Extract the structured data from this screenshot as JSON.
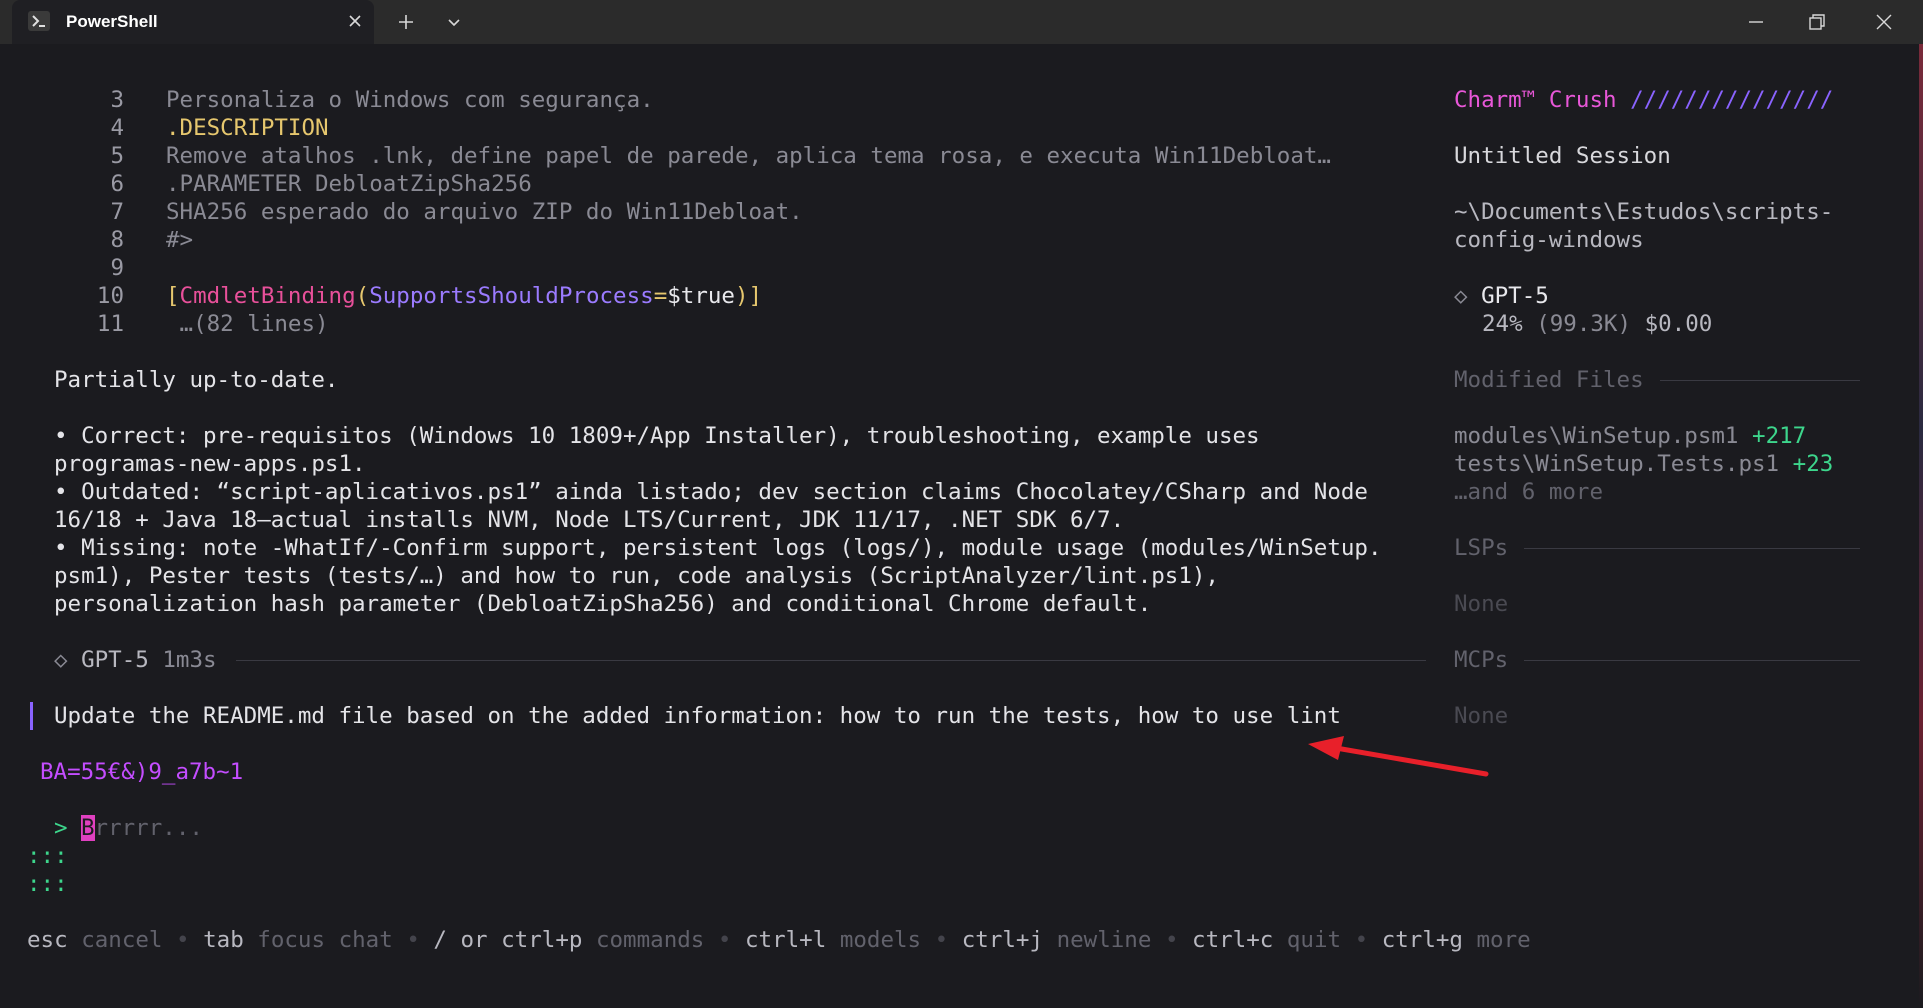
{
  "window": {
    "tab_title": "PowerShell",
    "icons": {
      "tab": "powershell-icon",
      "close": "close-icon",
      "new_tab": "plus-icon",
      "dropdown": "chevron-down-icon",
      "minimize": "minimize-icon",
      "maximize": "restore-icon",
      "window_close": "close-icon"
    }
  },
  "code": {
    "lines": [
      {
        "num": "3",
        "text": "Personaliza o Windows com segurança."
      },
      {
        "num": "4",
        "text": ".DESCRIPTION"
      },
      {
        "num": "5",
        "text": "Remove atalhos .lnk, define papel de parede, aplica tema rosa, e executa Win11Debloat…"
      },
      {
        "num": "6",
        "text": ".PARAMETER DebloatZipSha256"
      },
      {
        "num": "7",
        "text": "SHA256 esperado do arquivo ZIP do Win11Debloat."
      },
      {
        "num": "8",
        "text": "#>"
      },
      {
        "num": "9",
        "text": ""
      },
      {
        "num": "10",
        "parts": [
          "[",
          "CmdletBinding",
          "(",
          "SupportsShouldProcess",
          "=",
          "$true",
          ")]"
        ]
      },
      {
        "num": "11",
        "text": " …(82 lines)"
      }
    ]
  },
  "response": {
    "summary": "Partially up-to-date.",
    "bullets": [
      [
        "• Correct: pre-requisitos (Windows 10 1809+/App Installer), troubleshooting, example uses",
        "programas-new-apps.ps1."
      ],
      [
        "• Outdated: “script-aplicativos.ps1” ainda listado; dev section claims Chocolatey/CSharp and Node",
        "16/18 + Java 18—actual installs NVM, Node LTS/Current, JDK 11/17, .NET SDK 6/7."
      ],
      [
        "• Missing: note -WhatIf/-Confirm support, persistent logs (logs/), module usage (modules/WinSetup.",
        "psm1), Pester tests (tests/…) and how to run, code analysis (ScriptAnalyzer/lint.ps1),",
        "personalization hash parameter (DebloatZipSha256) and conditional Chrome default."
      ]
    ],
    "model_marker": "◇",
    "model": "GPT-5",
    "duration": "1m3s"
  },
  "user_message": "Update the README.md file based on the added information: how to run the tests, how to use lint",
  "spinner_text": "BA=55€&)9_a7b~1",
  "input": {
    "prompt": ">",
    "cursor_char": "B",
    "placeholder": "rrrrr...",
    "continuation": [
      ":::",
      ":::"
    ]
  },
  "shortcuts": [
    {
      "key": "esc",
      "label": "cancel"
    },
    {
      "key": "tab",
      "label": "focus chat"
    },
    {
      "key": "/ or ctrl+p",
      "label": "commands"
    },
    {
      "key": "ctrl+l",
      "label": "models"
    },
    {
      "key": "ctrl+j",
      "label": "newline"
    },
    {
      "key": "ctrl+c",
      "label": "quit"
    },
    {
      "key": "ctrl+g",
      "label": "more"
    }
  ],
  "sidebar": {
    "brand": "Charm™ Crush",
    "brand_slashes": "///////////////",
    "session_title": "Untitled Session",
    "path_line1": "~\\Documents\\Estudos\\scripts-",
    "path_line2": "config-windows",
    "model_marker": "◇",
    "model": "GPT-5",
    "usage_percent": "24%",
    "usage_tokens": "(99.3K)",
    "cost": "$0.00",
    "modified_files_header": "Modified Files",
    "modified_files": [
      {
        "path": "modules\\WinSetup.psm1",
        "delta": "+217"
      },
      {
        "path": "tests\\WinSetup.Tests.ps1",
        "delta": "+23"
      }
    ],
    "modified_more": "…and 6 more",
    "lsps_header": "LSPs",
    "lsps_value": "None",
    "mcps_header": "MCPs",
    "mcps_value": "None"
  },
  "colors": {
    "background": "#1b1b1f",
    "brand": "#e857d8",
    "brand_slashes": "#8a63ff",
    "added": "#3dd68c",
    "annotation_arrow": "#e8202a",
    "spinner": "#c44dff"
  }
}
